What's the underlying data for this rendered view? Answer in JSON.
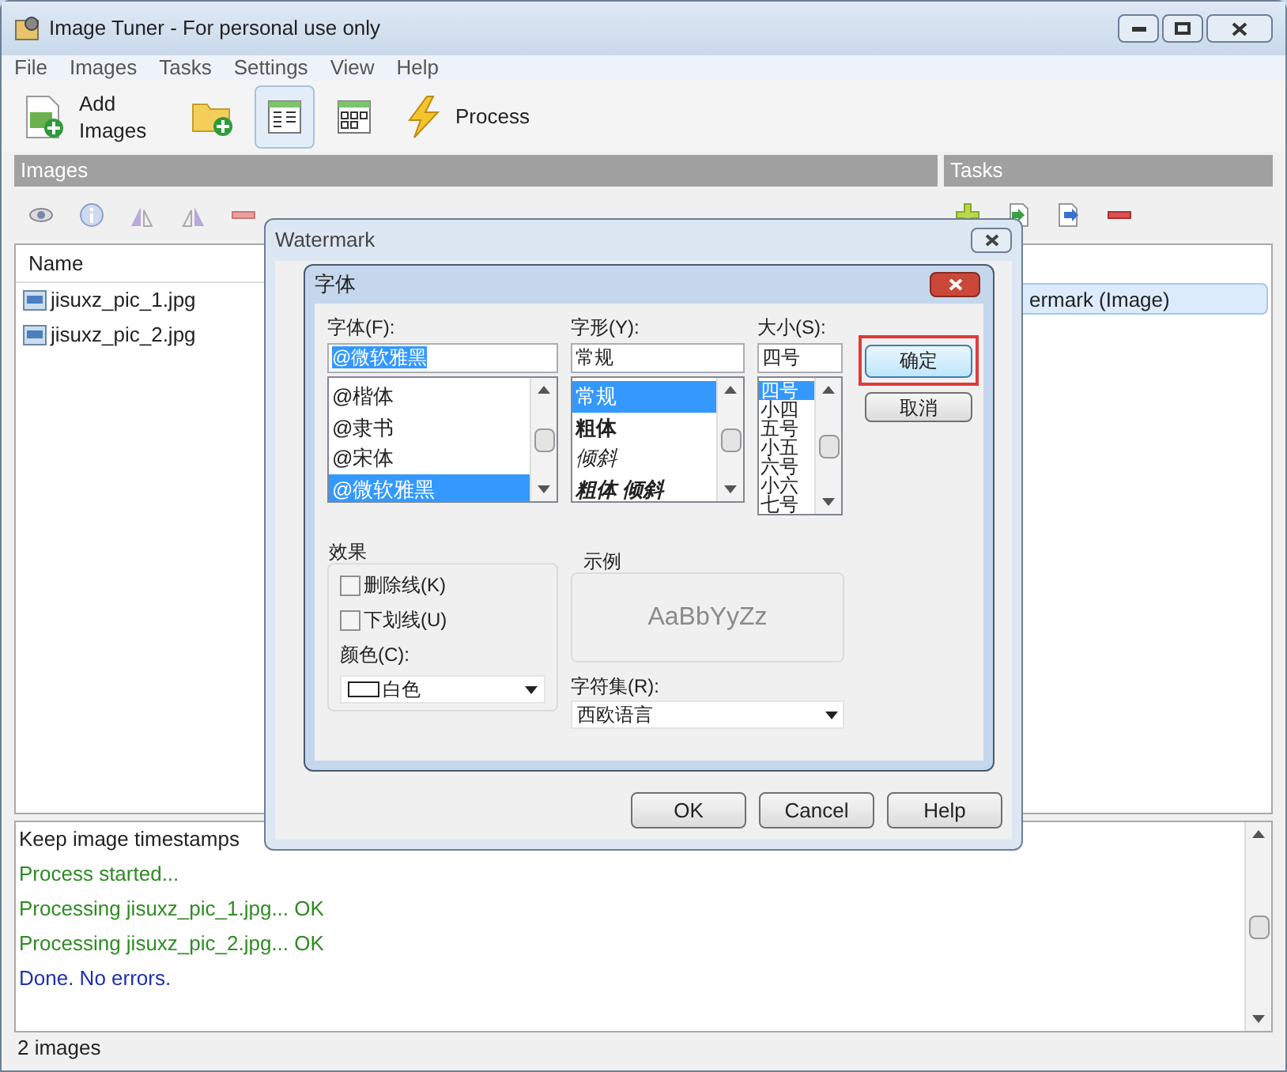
{
  "window": {
    "title": "Image Tuner - For personal use only"
  },
  "menu": [
    "File",
    "Images",
    "Tasks",
    "Settings",
    "View",
    "Help"
  ],
  "toolbar": [
    {
      "kind": "add",
      "label": "Add Images",
      "selected": false
    },
    {
      "kind": "folder",
      "selected": false
    },
    {
      "kind": "details",
      "selected": true
    },
    {
      "kind": "thumbs",
      "selected": false
    },
    {
      "kind": "process",
      "label": "Process",
      "selected": false
    }
  ],
  "images_panel": {
    "title": "Images",
    "column": "Name",
    "rows": [
      {
        "name": "jisuxz_pic_1.jpg"
      },
      {
        "name": "jisuxz_pic_2.jpg"
      }
    ]
  },
  "tasks_panel": {
    "title": "Tasks",
    "rows": [
      {
        "name": "ermark (Image)",
        "selected": true
      }
    ]
  },
  "log": [
    {
      "kind": "plain",
      "text": "Keep image timestamps"
    },
    {
      "kind": "info",
      "text": "Process started..."
    },
    {
      "kind": "info",
      "text": "Processing jisuxz_pic_1.jpg... OK"
    },
    {
      "kind": "info",
      "text": "Processing jisuxz_pic_2.jpg... OK"
    },
    {
      "kind": "done",
      "text": "Done. No errors."
    }
  ],
  "status_bar": "2 images",
  "watermark_dialog": {
    "title": "Watermark",
    "buttons": [
      "OK",
      "Cancel",
      "Help"
    ]
  },
  "font_dialog": {
    "title": "字体",
    "font": {
      "label": "字体(F):",
      "value": "@微软雅黑",
      "items": [
        {
          "text": "@楷体",
          "selected": false
        },
        {
          "text": "@隶书",
          "selected": false
        },
        {
          "text": "@宋体",
          "selected": false
        },
        {
          "text": "@微软雅黑",
          "selected": true
        }
      ]
    },
    "style": {
      "label": "字形(Y):",
      "value": "常规",
      "items": [
        {
          "text": "常规",
          "kind": "regular",
          "selected": true
        },
        {
          "text": "粗体",
          "kind": "bold",
          "selected": false
        },
        {
          "text": "倾斜",
          "kind": "italic",
          "selected": false
        },
        {
          "text": "粗体 倾斜",
          "kind": "bolditalic",
          "selected": false
        }
      ]
    },
    "size": {
      "label": "大小(S):",
      "value": "四号",
      "items": [
        {
          "text": "四号",
          "selected": true
        },
        {
          "text": "小四",
          "selected": false
        },
        {
          "text": "五号",
          "selected": false
        },
        {
          "text": "小五",
          "selected": false
        },
        {
          "text": "六号",
          "selected": false
        },
        {
          "text": "小六",
          "selected": false
        },
        {
          "text": "七号",
          "selected": false
        }
      ]
    },
    "ok": "确定",
    "cancel": "取消",
    "effects": {
      "title": "效果",
      "options": [
        {
          "label": "删除线(K)",
          "checked": false
        },
        {
          "label": "下划线(U)",
          "checked": false
        }
      ],
      "color_label": "颜色(C):",
      "color": {
        "name": "白色",
        "color": "#ffffff"
      }
    },
    "sample": {
      "title": "示例",
      "text": "AaBbYyZz"
    },
    "charset": {
      "label": "字符集(R):",
      "value": "西欧语言"
    }
  }
}
